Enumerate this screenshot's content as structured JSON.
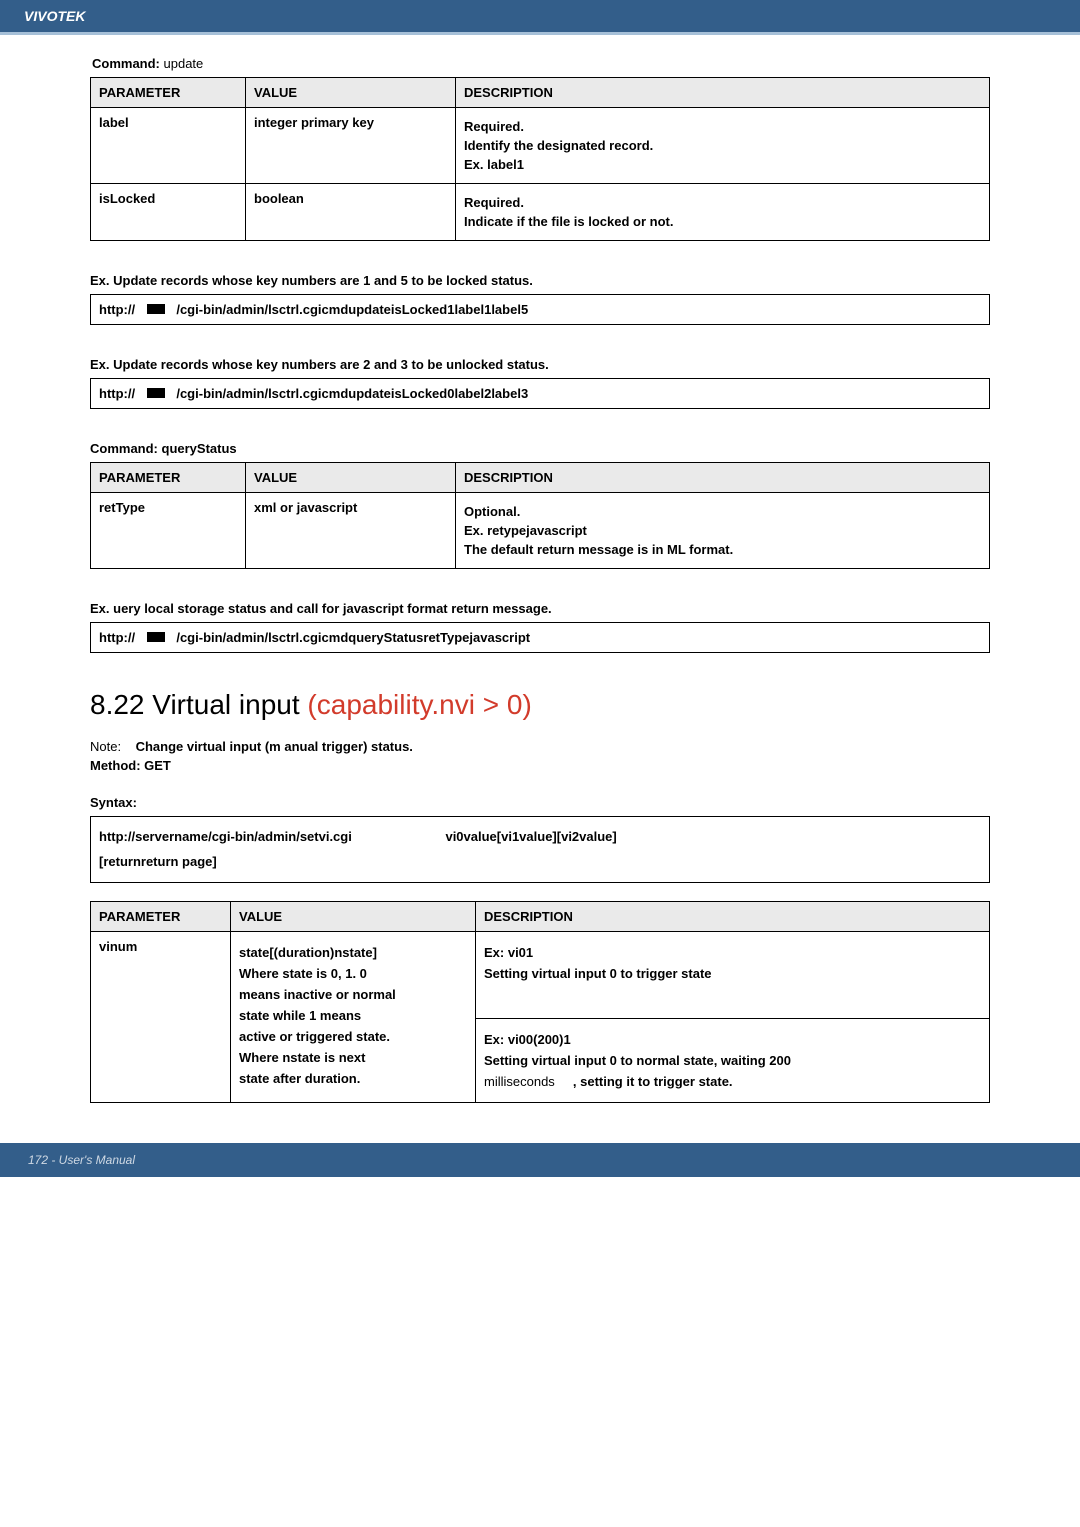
{
  "header": {
    "brand": "VIVOTEK"
  },
  "command_update": {
    "title_prefix": "Command:",
    "title_value": "update",
    "cols": {
      "param": "PARAMETER",
      "value": "VALUE",
      "desc": "DESCRIPTION"
    },
    "rows": [
      {
        "param": "label",
        "value": "integer primary key",
        "desc": [
          "Required.",
          "Identify the designated record.",
          "Ex. label1"
        ]
      },
      {
        "param": "isLocked",
        "value": "boolean",
        "desc": [
          "Required.",
          "Indicate if the file is locked or not."
        ]
      }
    ]
  },
  "ex1": {
    "label": "Ex. Update records whose key numbers are 1 and 5 to be locked status.",
    "prefix": "http://",
    "path": "/cgi-bin/admin/lsctrl.cgicmdupdateisLocked1label1label5"
  },
  "ex2": {
    "label": "Ex. Update records whose key numbers are 2 and 3 to be unlocked status.",
    "prefix": "http://",
    "path": "/cgi-bin/admin/lsctrl.cgicmdupdateisLocked0label2label3"
  },
  "command_query": {
    "title": "Command: queryStatus",
    "cols": {
      "param": "PARAMETER",
      "value": "VALUE",
      "desc": "DESCRIPTION"
    },
    "rows": [
      {
        "param": "retType",
        "value": "xml or javascript",
        "desc": [
          "Optional.",
          "Ex. retypejavascript",
          "The default return message is in ML format."
        ]
      }
    ]
  },
  "ex3": {
    "label": "Ex. uery local storage status and call for javascript format return message.",
    "prefix": "http://",
    "path": "/cgi-bin/admin/lsctrl.cgicmdqueryStatusretTypejavascript"
  },
  "section": {
    "num": "8.22 Virtual input",
    "red": "(capability.nvi > 0)",
    "note_prefix": "Note:",
    "note_text": "Change virtual input (m   anual trigger) status.",
    "method": "Method: GET"
  },
  "syntax": {
    "label": "Syntax:",
    "left": "http://servername/cgi-bin/admin/setvi.cgi",
    "right": "vi0value[vi1value][vi2value]",
    "line2": "[returnreturn page]"
  },
  "last_table": {
    "cols": {
      "param": "PARAMETER",
      "value": "VALUE",
      "desc": "DESCRIPTION"
    },
    "row": {
      "param": "vinum",
      "value_l1": "state[(duration)nstate]",
      "value_l2": "Where state is 0, 1. 0",
      "value_l3": "means inactive or normal",
      "value_l4": "state while 1 means",
      "value_l5": "active or triggered state.",
      "value_l6": "Where nstate is next",
      "value_l7": "state after duration.",
      "desc_l1": "Ex: vi01",
      "desc_l2": "Setting virtual input 0 to trigger state",
      "desc_l3": "Ex: vi00(200)1",
      "desc_l4": "Setting virtual input 0 to normal state, waiting 200",
      "desc_l5_a": "milliseconds",
      "desc_l5_b": ", setting it to trigger state."
    }
  },
  "footer": {
    "text": "172 - User's Manual"
  }
}
